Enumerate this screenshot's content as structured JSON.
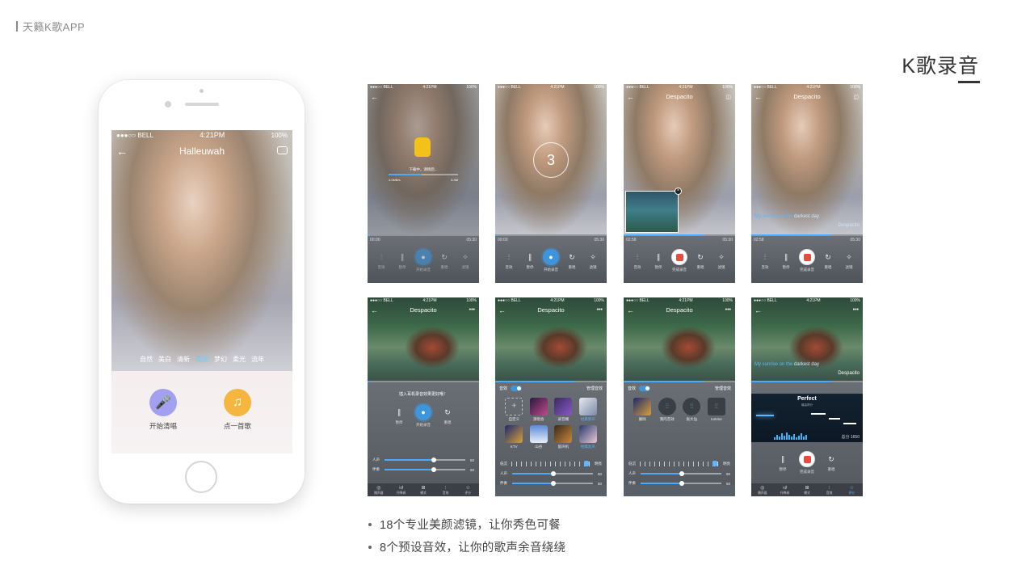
{
  "header": {
    "brand": "天籁K歌APP",
    "section_title": "K歌录音"
  },
  "phone": {
    "status": {
      "carrier": "●●●○○ BELL",
      "time": "4:21PM",
      "battery": "100%"
    },
    "song_title": "Halleuwah",
    "filters": [
      "自然",
      "美白",
      "清新",
      "美颜",
      "梦幻",
      "柔光",
      "流年"
    ],
    "active_filter": "美颜",
    "buttons": {
      "sing": "开始清唱",
      "pick": "点一首歌"
    },
    "colors": {
      "sing": "#a3a0f0",
      "pick": "#f5b640"
    }
  },
  "screens_row1": [
    {
      "status": {
        "carrier": "●●●○○ BELL",
        "time": "4:21PM",
        "battery": "100%"
      },
      "download_text": "下载中，请稍后...",
      "download_left": "4.0MB/s",
      "download_right": "3.3M",
      "time_left": "00:00",
      "time_right": "05:30",
      "controls": [
        "音效",
        "暂停",
        "开始录音",
        "重唱",
        "滤镜"
      ]
    },
    {
      "status": {
        "carrier": "●●●○○ BELL",
        "time": "4:21PM",
        "battery": "100%"
      },
      "countdown": "3",
      "time_left": "00:00",
      "time_right": "05:30",
      "controls": [
        "音效",
        "暂停",
        "开始录音",
        "重唱",
        "滤镜"
      ]
    },
    {
      "status": {
        "carrier": "●●●○○ BELL",
        "time": "4:21PM",
        "battery": "100%"
      },
      "title": "Despacito",
      "time_left": "02:58",
      "time_right": "05:30",
      "controls": [
        "音效",
        "暂停",
        "完成录音",
        "重唱",
        "滤镜"
      ]
    },
    {
      "status": {
        "carrier": "●●●○○ BELL",
        "time": "4:21PM",
        "battery": "100%"
      },
      "title": "Despacito",
      "lyric_sung": "My sunrise on the",
      "lyric_rest": " darkest day",
      "lyric_song": "Despacito",
      "time_left": "02:58",
      "time_right": "05:30",
      "controls": [
        "音效",
        "暂停",
        "完成录音",
        "重唱",
        "滤镜"
      ]
    }
  ],
  "screens_row2": [
    {
      "status": {
        "carrier": "●●●○○ BELL",
        "time": "4:21PM",
        "battery": "100%"
      },
      "title": "Despacito",
      "hint": "插入耳机录音效果更好哦！",
      "controls": [
        "暂停",
        "开始录音",
        "重唱"
      ],
      "sliders": [
        {
          "label": "人声",
          "value": "50"
        },
        {
          "label": "伴奏",
          "value": "50"
        }
      ],
      "tabs": [
        "播声器",
        "升降调",
        "模式",
        "音效",
        "评分"
      ]
    },
    {
      "status": {
        "carrier": "●●●○○ BELL",
        "time": "4:21PM",
        "battery": "100%"
      },
      "title": "Despacito",
      "fx_label": "音效",
      "fx_manage": "管理音效",
      "effects": [
        "自定义",
        "演唱会",
        "录音棚",
        "经典男声",
        "KTV",
        "山谷",
        "留声机",
        "经典女声"
      ],
      "selected_effects": [
        "经典男声",
        "经典女声"
      ],
      "tone_left": "低沉",
      "tone_right": "明亮",
      "sliders": [
        {
          "label": "人声",
          "value": "50"
        },
        {
          "label": "伴奏",
          "value": "50"
        }
      ]
    },
    {
      "status": {
        "carrier": "●●●○○ BELL",
        "time": "4:21PM",
        "battery": "100%"
      },
      "title": "Despacito",
      "fx_label": "音效",
      "fx_manage": "管理音效",
      "eq_presets": [
        "删除",
        "我的音效",
        "张大仙",
        "rumme"
      ],
      "tone_left": "低沉",
      "tone_right": "明亮",
      "sliders": [
        {
          "label": "人声",
          "value": "50"
        },
        {
          "label": "伴奏",
          "value": "50"
        }
      ]
    },
    {
      "status": {
        "carrier": "●●●○○ BELL",
        "time": "4:21PM",
        "battery": "100%"
      },
      "lyric_sung": "My sunrise on the",
      "lyric_rest": " darkest day",
      "lyric_song": "Despacito",
      "perfect": "Perfect",
      "perfect_sub": "最高得分",
      "score": "总分 1650",
      "controls": [
        "暂停",
        "完成录音",
        "重唱"
      ],
      "tabs": [
        "播声器",
        "升降调",
        "模式",
        "音效",
        "评分"
      ]
    }
  ],
  "bullets": [
    "18个专业美颜滤镜，让你秀色可餐",
    "8个预设音效，让你的歌声余音绕绕"
  ]
}
